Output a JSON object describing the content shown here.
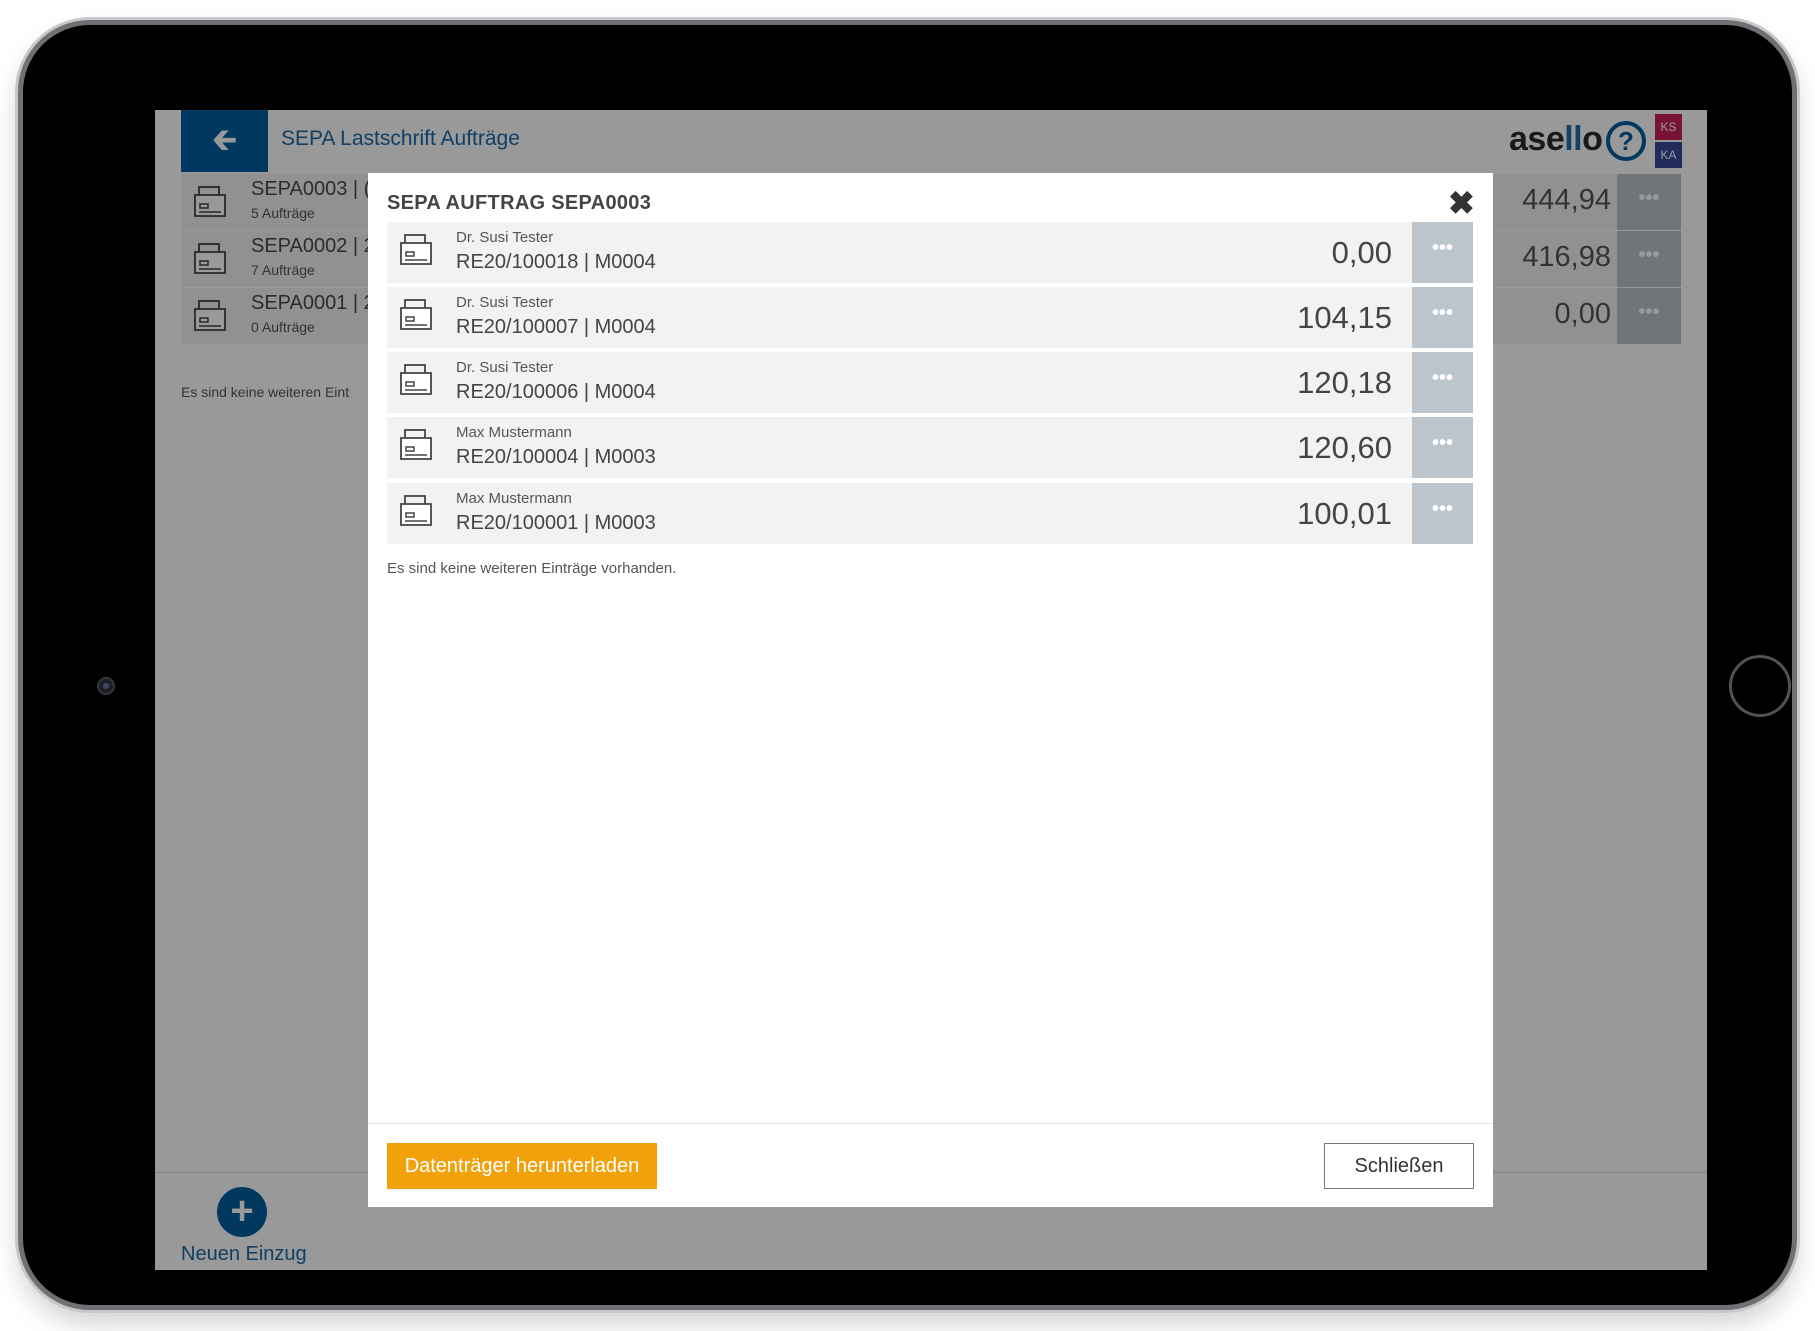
{
  "header": {
    "back_icon": "arrow-left-icon",
    "title": "SEPA Lastschrift Aufträge",
    "logo_prefix": "ase",
    "logo_accent": "ll",
    "logo_suffix": "o",
    "help_icon": "question-circle-icon",
    "help_glyph": "?",
    "badges": [
      "KS",
      "KA"
    ]
  },
  "background_list": {
    "rows": [
      {
        "code": "SEPA0003 | (",
        "sub": "5 Aufträge",
        "amount": "444,94"
      },
      {
        "code": "SEPA0002 | 2",
        "sub": "7 Aufträge",
        "amount": "416,98"
      },
      {
        "code": "SEPA0001 | 2",
        "sub": "0 Aufträge",
        "amount": "0,00"
      }
    ],
    "empty_text": "Es sind keine weiteren Eint"
  },
  "footer": {
    "add_icon": "plus-circle-icon",
    "add_glyph": "+",
    "add_label": "Neuen Einzug"
  },
  "modal": {
    "title": "SEPA AUFTRAG SEPA0003",
    "close_glyph": "✖",
    "entries": [
      {
        "name": "Dr. Susi Tester",
        "ref": "RE20/100018 | M0004",
        "amount": "0,00"
      },
      {
        "name": "Dr. Susi Tester",
        "ref": "RE20/100007 | M0004",
        "amount": "104,15"
      },
      {
        "name": "Dr. Susi Tester",
        "ref": "RE20/100006 | M0004",
        "amount": "120,18"
      },
      {
        "name": "Max Mustermann",
        "ref": "RE20/100004 | M0003",
        "amount": "120,60"
      },
      {
        "name": "Max Mustermann",
        "ref": "RE20/100001 | M0003",
        "amount": "100,01"
      }
    ],
    "empty_text": "Es sind keine weiteren Einträge vorhanden.",
    "download_label": "Datenträger herunterladen",
    "close_label": "Schließen"
  },
  "colors": {
    "primary": "#005e9f",
    "accent_orange": "#f1a20a",
    "badge_ks": "#c8205d",
    "badge_ka": "#384a98"
  }
}
